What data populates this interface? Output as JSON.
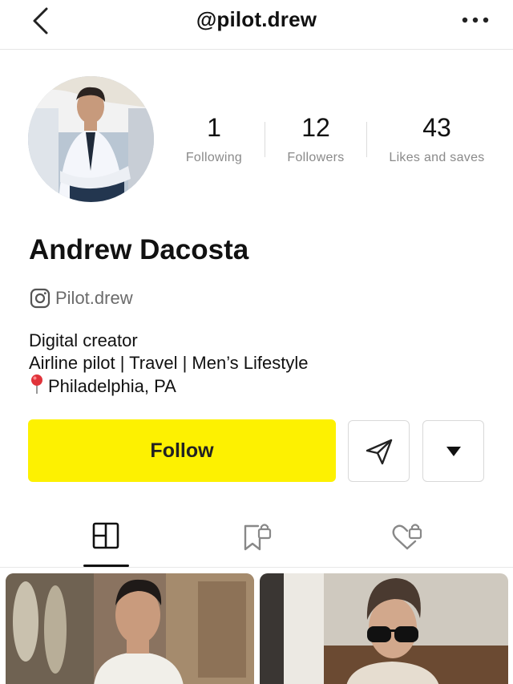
{
  "header": {
    "handle": "@pilot.drew"
  },
  "profile": {
    "name": "Andrew Dacosta",
    "instagram_handle": "Pilot.drew",
    "stats": [
      {
        "value": "1",
        "label": "Following"
      },
      {
        "value": "12",
        "label": "Followers"
      },
      {
        "value": "43",
        "label": "Likes and saves"
      }
    ],
    "bio": {
      "line1": "Digital creator",
      "line2": "Airline pilot | Travel | Men’s Lifestyle",
      "location": "Philadelphia, PA"
    }
  },
  "actions": {
    "follow_label": "Follow",
    "follow_color": "#fdf101"
  },
  "tabs": [
    {
      "icon": "grid-layout-icon",
      "active": true
    },
    {
      "icon": "bookmark-lock-icon",
      "active": false
    },
    {
      "icon": "heart-lock-icon",
      "active": false
    }
  ]
}
